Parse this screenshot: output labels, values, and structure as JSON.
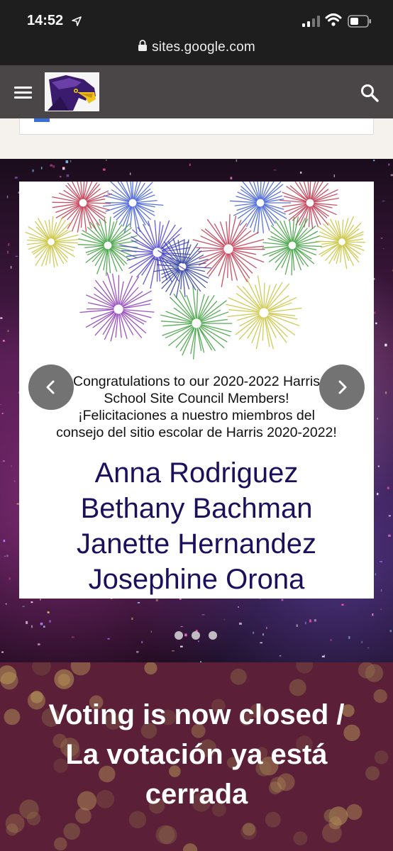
{
  "status_bar": {
    "time": "14:52"
  },
  "browser": {
    "url": "sites.google.com"
  },
  "header": {
    "menu_icon": "hamburger-menu-icon",
    "logo_icon": "eagle-mascot-logo",
    "search_icon": "search-icon"
  },
  "hero": {
    "congrats_line1": "Congratulations to our 2020-2022 Harris",
    "congrats_line2": "School Site Council Members!",
    "congrats_line3": "¡Felicitaciones a nuestro miembros del",
    "congrats_line4": "consejo del sitio escolar de Harris 2020-2022!",
    "names": [
      "Anna Rodriguez",
      "Bethany Bachman",
      "Janette Hernandez",
      "Josephine Orona"
    ],
    "prev_icon": "chevron-left-icon",
    "next_icon": "chevron-right-icon",
    "slide_count": 3,
    "active_slide": 1
  },
  "voting": {
    "line1": "Voting is now closed /",
    "line2": "La votación ya está",
    "line3": "cerrada"
  },
  "colors": {
    "header_bg": "#4a4546",
    "names_color": "#1c0f5c",
    "voting_bg": "#5b1f37"
  }
}
